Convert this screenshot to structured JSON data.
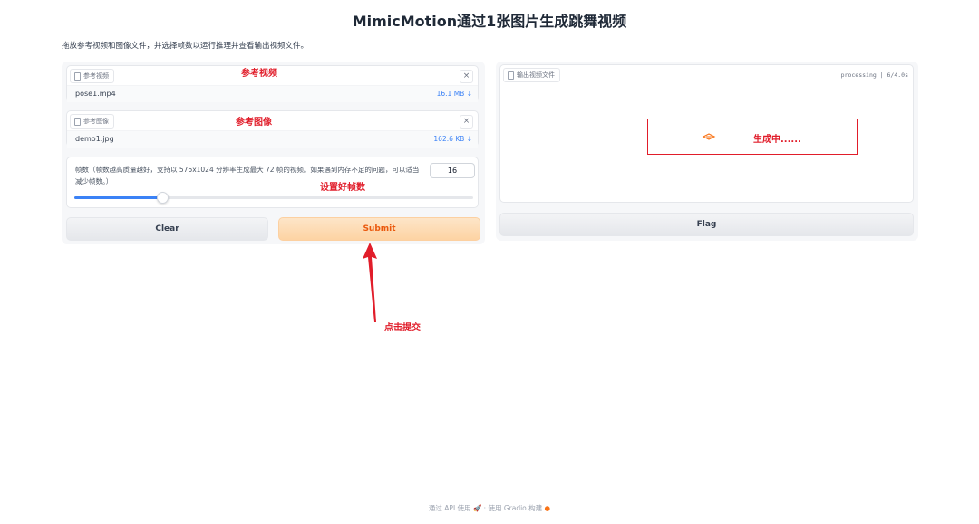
{
  "header": {
    "title": "MimicMotion通过1张图片生成跳舞视频",
    "description": "拖放参考视频和图像文件，并选择帧数以运行推理并查看输出视频文件。"
  },
  "inputs": {
    "ref_video": {
      "tag_label": "参考视频",
      "file_name": "pose1.mp4",
      "file_size": "16.1 MB ↓",
      "close": "×"
    },
    "ref_image": {
      "tag_label": "参考图像",
      "file_name": "demo1.jpg",
      "file_size": "162.6 KB ↓",
      "close": "×"
    },
    "frames": {
      "label": "帧数（帧数越高质量越好，支持以 576x1024 分辨率生成最大 72 帧的视频。如果遇到内存不足的问题，可以适当减少帧数。）",
      "value": "16",
      "slider_fraction": 0.22
    }
  },
  "buttons": {
    "clear": "Clear",
    "submit": "Submit",
    "flag": "Flag"
  },
  "output": {
    "tag_label": "输出视频文件",
    "progress": "processing | 6/4.0s"
  },
  "annotations": {
    "ref_video": "参考视频",
    "ref_image": "参考图像",
    "frames": "设置好帧数",
    "generating": "生成中......",
    "click_submit": "点击提交",
    "color": "#e11d2a"
  },
  "footer": {
    "api": "通过 API 使用",
    "sep": "·",
    "built": "使用 Gradio 构建"
  }
}
